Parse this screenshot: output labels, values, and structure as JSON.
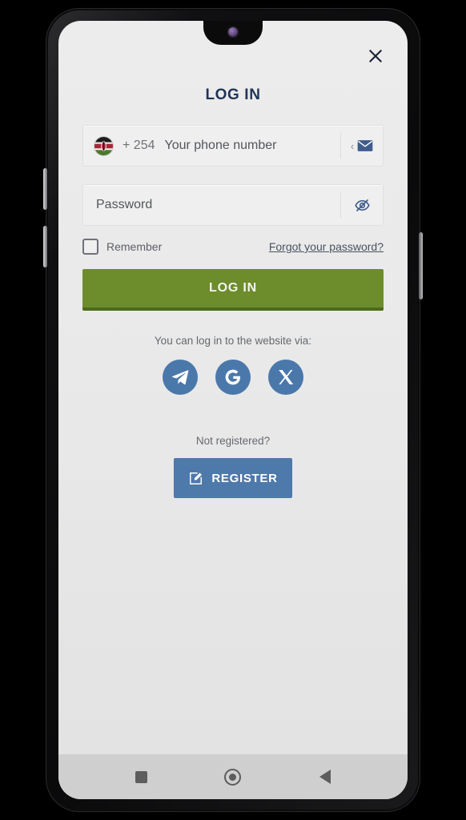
{
  "colors": {
    "title": "#1f3557",
    "login_button": "#6d8c2c",
    "login_button_shadow": "#4e6a1d",
    "register_button": "#4e79ab",
    "social_circle": "#4a78ab",
    "screen_background": "#e9e9e9",
    "field_background": "#efefef",
    "nav_bar": "#cfcfcf"
  },
  "header": {
    "title": "LOG IN",
    "close_icon": "close-icon"
  },
  "phone_field": {
    "flag_icon": "kenya-flag-icon",
    "dial_code": "+ 254",
    "value": "",
    "placeholder": "Your phone number",
    "switch_chevron": "‹",
    "switch_icon": "email-icon"
  },
  "password_field": {
    "value": "",
    "placeholder": "Password",
    "toggle_icon": "eye-slash-icon"
  },
  "options": {
    "remember_label": "Remember",
    "remember_checked": false,
    "forgot_password_label": "Forgot your password?"
  },
  "login_button": {
    "label": "LOG IN"
  },
  "social": {
    "caption": "You can log in to the website via:",
    "items": [
      {
        "name": "telegram",
        "icon": "telegram-icon"
      },
      {
        "name": "google",
        "icon": "google-icon"
      },
      {
        "name": "x",
        "icon": "x-icon"
      }
    ]
  },
  "register": {
    "caption": "Not registered?",
    "button_label": "REGISTER",
    "button_icon": "edit-pencil-icon"
  },
  "nav_bar": {
    "recents": "square-recents-icon",
    "home": "circle-home-icon",
    "back": "triangle-back-icon"
  }
}
